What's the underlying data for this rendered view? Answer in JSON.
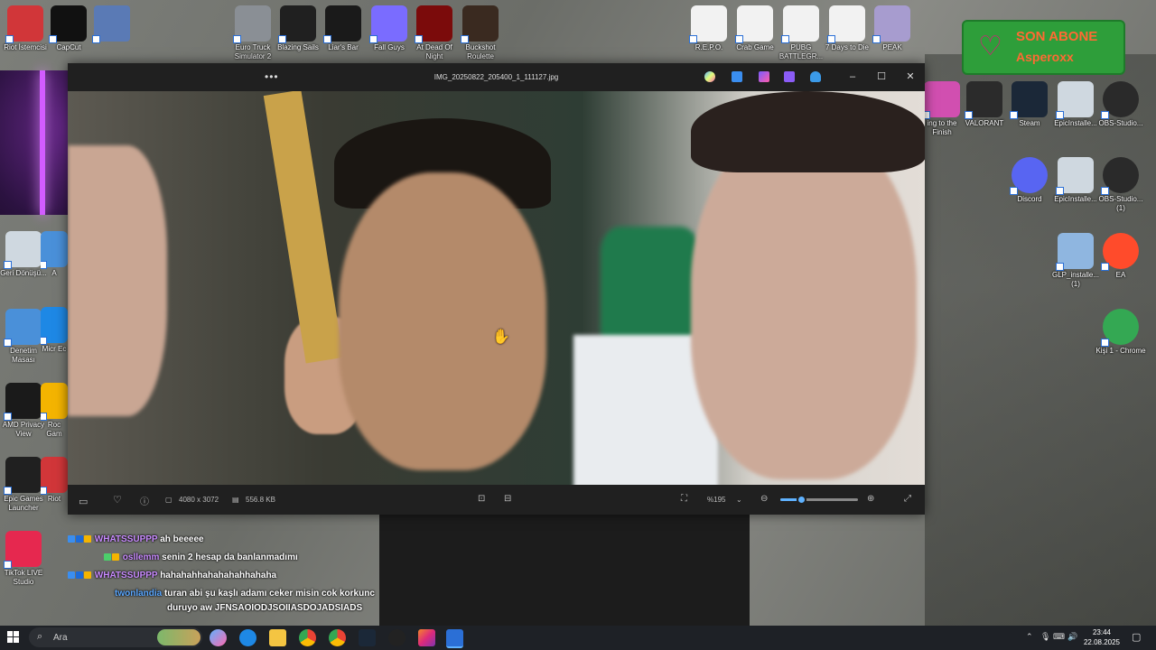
{
  "desktop_top_icons": [
    {
      "label": "Riot İstemcisi",
      "icon": "riot-icon",
      "color": "#d13639"
    },
    {
      "label": "CapCut",
      "icon": "capcut-icon",
      "color": "#111111"
    },
    {
      "label": "",
      "icon": "avatar-icon",
      "color": "#5a7ab5"
    },
    {
      "label": "Euro Truck Simulator 2",
      "icon": "truck-icon",
      "color": "#8a8f95"
    },
    {
      "label": "Blazing Sails",
      "icon": "epic-icon",
      "color": "#202020"
    },
    {
      "label": "Liar's Bar",
      "icon": "liars-bar-icon",
      "color": "#1a1a1a"
    },
    {
      "label": "Fall Guys",
      "icon": "fall-guys-icon",
      "color": "#7a6cff"
    },
    {
      "label": "At Dead Of Night",
      "icon": "dead-of-night-icon",
      "color": "#7b0b0b"
    },
    {
      "label": "Buckshot Roulette",
      "icon": "buckshot-icon",
      "color": "#3a2a20"
    },
    {
      "label": "R.E.P.O.",
      "icon": "file-icon",
      "color": "#f2f2f2"
    },
    {
      "label": "Crab Game",
      "icon": "file-icon",
      "color": "#f2f2f2"
    },
    {
      "label": "PUBG BATTLEGR...",
      "icon": "file-icon",
      "color": "#f2f2f2"
    },
    {
      "label": "7 Days to Die",
      "icon": "file-icon",
      "color": "#f2f2f2"
    },
    {
      "label": "PEAK",
      "icon": "peak-icon",
      "color": "#a79ccf"
    }
  ],
  "desktop_left_icons": [
    {
      "label": "Geri Dönüşü...",
      "icon": "recycle-bin-icon",
      "color": "#cfd8e0"
    },
    {
      "label": "Denetim Masası",
      "icon": "control-panel-icon",
      "color": "#4a90d9"
    },
    {
      "label": "AMD Privacy View",
      "icon": "amd-eye-icon",
      "color": "#1a1a1a"
    },
    {
      "label": "Epic Games Launcher",
      "icon": "epic-icon",
      "color": "#202020"
    },
    {
      "label": "TikTok LIVE Studio",
      "icon": "tiktok-icon",
      "color": "#e6284f"
    }
  ],
  "desktop_left_partial_icons": [
    {
      "label": "A",
      "icon": "app-icon",
      "color": "#4a90d9"
    },
    {
      "label": "Micr Ec",
      "icon": "edge-icon",
      "color": "#1e88e5"
    },
    {
      "label": "Roc Gam",
      "icon": "rockstar-icon",
      "color": "#f4b400"
    },
    {
      "label": "Riot",
      "icon": "riot-icon",
      "color": "#d13639"
    }
  ],
  "desktop_right_icons": [
    {
      "label": "ing to the Finish",
      "icon": "snake-icon",
      "color": "#d14fb0"
    },
    {
      "label": "VALORANT",
      "icon": "valorant-icon",
      "color": "#2b2b2b"
    },
    {
      "label": "Steam",
      "icon": "steam-icon",
      "color": "#1b2838"
    },
    {
      "label": "EpicInstalle...",
      "icon": "installer-icon",
      "color": "#cfd8e0"
    },
    {
      "label": "OBS-Studio...",
      "icon": "obs-icon",
      "color": "#2a2a2a"
    },
    {
      "label": "Discord",
      "icon": "discord-icon",
      "color": "#5865f2"
    },
    {
      "label": "EpicInstalle...",
      "icon": "installer-icon",
      "color": "#cfd8e0"
    },
    {
      "label": "OBS-Studio... (1)",
      "icon": "obs-icon",
      "color": "#2a2a2a"
    },
    {
      "label": "GLP_installe... (1)",
      "icon": "globe-icon",
      "color": "#8fb6e0"
    },
    {
      "label": "EA",
      "icon": "ea-icon",
      "color": "#ff4b2b"
    },
    {
      "label": "Kişi 1 - Chrome",
      "icon": "chrome-icon",
      "color": "#34a853"
    }
  ],
  "viewer": {
    "title": "IMG_20250822_205400_1_111127.jpg",
    "menu_label": "•••",
    "dimensions": "4080 x 3072",
    "file_size": "556.8 KB",
    "zoom_label": "%195",
    "zoom_level": 0.27,
    "accent": "#5fb2ff"
  },
  "subscriber_card": {
    "line1": "SON ABONE",
    "line2": "Asperoxx",
    "bg": "#2e9e3a",
    "text_color": "#ff6a33"
  },
  "chat": [
    {
      "user": "WHATSSUPPP",
      "user_color": "#c98bff",
      "message": "ah beeeee"
    },
    {
      "user": "osllemm",
      "user_color": "#c98bff",
      "message": "senin 2 hesap da banlanmadımı"
    },
    {
      "user": "WHATSSUPPP",
      "user_color": "#c98bff",
      "message": "hahahahhahahahahhahaha"
    },
    {
      "user": "twonlandia",
      "user_color": "#5aa7ff",
      "message": "turan abi şu kaşlı adamı ceker misin cok korkunc"
    },
    {
      "user": "",
      "user_color": "#ffffff",
      "message": "duruyo aw JFNSAOIODJSOIIASDOJADSIADS"
    }
  ],
  "taskbar": {
    "search_placeholder": "Ara",
    "time": "23:44",
    "date": "22.08.2025"
  }
}
